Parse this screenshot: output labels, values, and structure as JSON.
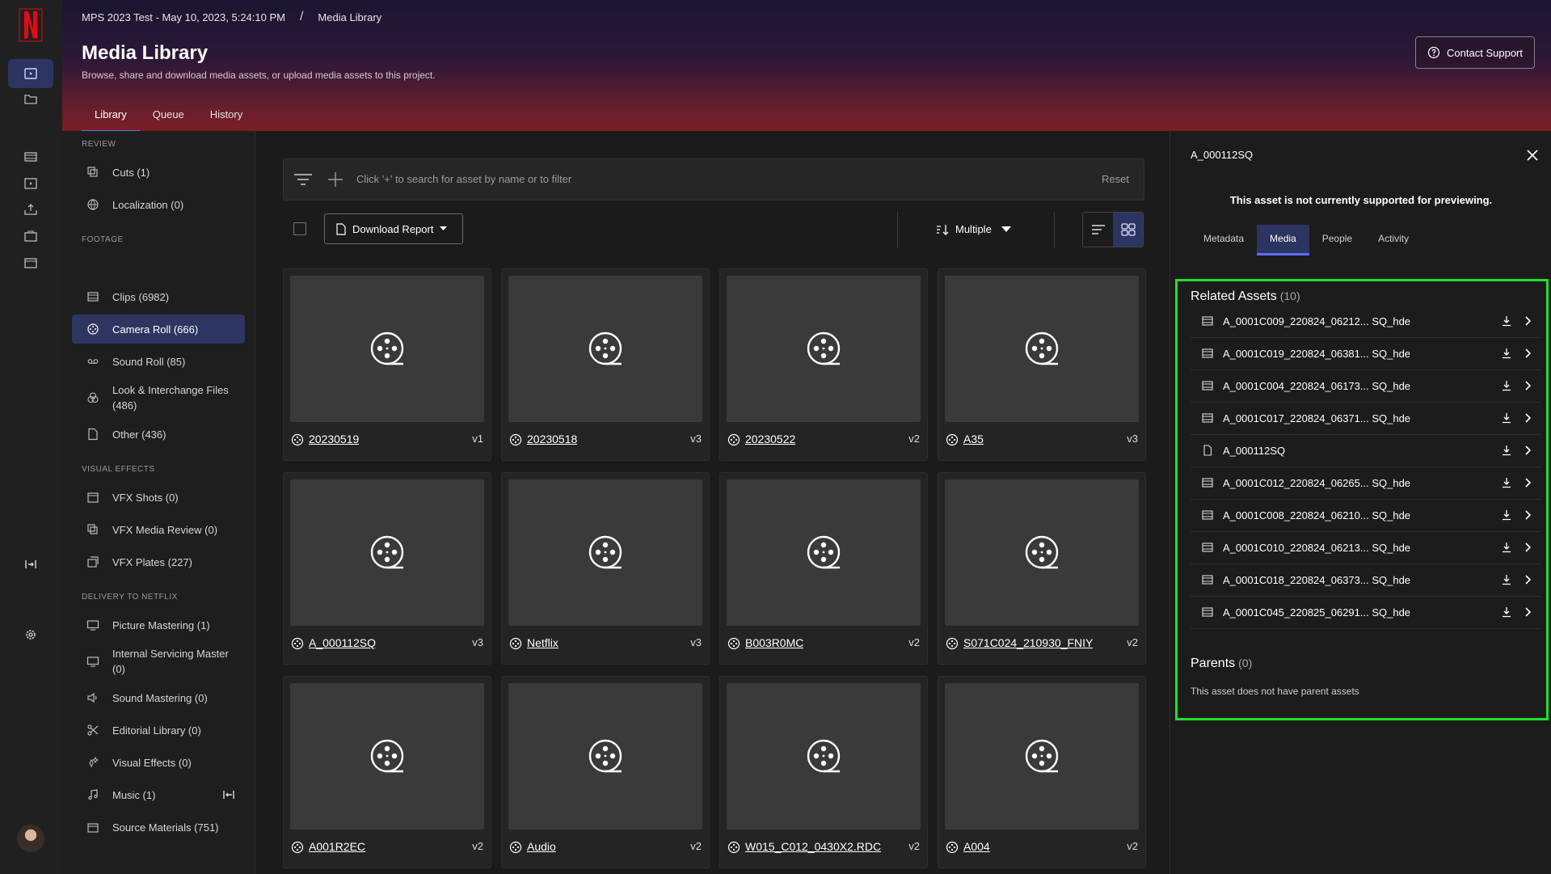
{
  "header": {
    "project": "MPS 2023 Test - May 10, 2023, 5:24:10 PM",
    "separator": "/",
    "crumb": "Media Library",
    "title": "Media Library",
    "subtitle": "Browse, share and download media assets, or upload media assets to this project.",
    "support_label": "Contact Support",
    "tabs": [
      "Library",
      "Queue",
      "History"
    ]
  },
  "nav": {
    "sections": {
      "review": "REVIEW",
      "footage": "FOOTAGE",
      "vfx": "VISUAL EFFECTS",
      "delivery": "DELIVERY TO NETFLIX"
    },
    "review": [
      "Cuts (1)",
      "Localization (0)"
    ],
    "footage": [
      "Clips (6982)",
      "Camera Roll (666)",
      "Sound Roll (85)",
      "Look & Interchange Files (486)",
      "Other (436)"
    ],
    "vfx": [
      "VFX Shots (0)",
      "VFX Media Review (0)",
      "VFX Plates (227)"
    ],
    "delivery": [
      "Picture Mastering (1)",
      "Internal Servicing Master (0)",
      "Sound Mastering (0)",
      "Editorial Library (0)",
      "Visual Effects (0)",
      "Music (1)",
      "Source Materials (751)"
    ]
  },
  "toolbar": {
    "search_placeholder": "Click '+' to search for asset by name or to filter",
    "reset_label": "Reset",
    "download_label": "Download Report",
    "sort_label": "Multiple"
  },
  "cards": [
    {
      "name": "20230519",
      "version": "v1"
    },
    {
      "name": "20230518",
      "version": "v3"
    },
    {
      "name": "20230522",
      "version": "v2"
    },
    {
      "name": "A35",
      "version": "v3"
    },
    {
      "name": "A_000112SQ",
      "version": "v3"
    },
    {
      "name": "Netflix",
      "version": "v3"
    },
    {
      "name": "B003R0MC",
      "version": "v2"
    },
    {
      "name": "S071C024_210930_FNIY",
      "version": "v2"
    },
    {
      "name": "A001R2EC",
      "version": "v2"
    },
    {
      "name": "Audio",
      "version": "v2"
    },
    {
      "name": "W015_C012_0430X2.RDC",
      "version": "v2"
    },
    {
      "name": "A004",
      "version": "v2"
    }
  ],
  "panel": {
    "title": "A_000112SQ",
    "note": "This asset is not currently supported for previewing.",
    "tabs": [
      "Metadata",
      "Media",
      "People",
      "Activity"
    ],
    "related_title": "Related Assets",
    "related_count": "(10)",
    "related": [
      {
        "name": "A_0001C009_220824_06212... SQ_hde",
        "icon": "film-icon"
      },
      {
        "name": "A_0001C019_220824_06381... SQ_hde",
        "icon": "film-icon"
      },
      {
        "name": "A_0001C004_220824_06173... SQ_hde",
        "icon": "film-icon"
      },
      {
        "name": "A_0001C017_220824_06371... SQ_hde",
        "icon": "film-icon"
      },
      {
        "name": "A_000112SQ",
        "icon": "file-icon"
      },
      {
        "name": "A_0001C012_220824_06265... SQ_hde",
        "icon": "film-icon"
      },
      {
        "name": "A_0001C008_220824_06210... SQ_hde",
        "icon": "film-icon"
      },
      {
        "name": "A_0001C010_220824_06213... SQ_hde",
        "icon": "film-icon"
      },
      {
        "name": "A_0001C018_220824_06373... SQ_hde",
        "icon": "film-icon"
      },
      {
        "name": "A_0001C045_220825_06291... SQ_hde",
        "icon": "film-icon"
      }
    ],
    "parents_title": "Parents",
    "parents_count": "(0)",
    "parents_empty": "This asset does not have parent assets"
  },
  "colors": {
    "accent": "#5b6cf0",
    "highlight": "#1fe02a",
    "netflix_red": "#e50914"
  }
}
